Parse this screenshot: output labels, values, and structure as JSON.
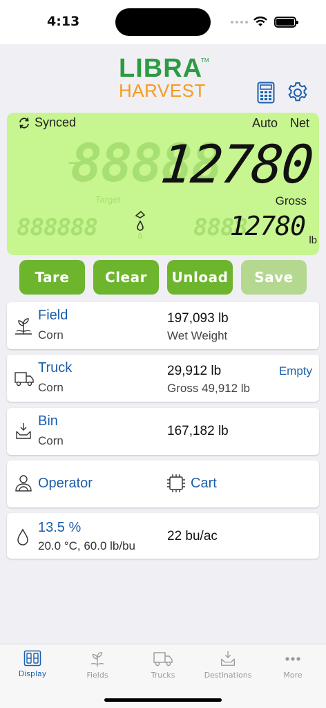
{
  "status_bar": {
    "time": "4:13"
  },
  "header": {
    "logo_top": "LIBRA",
    "logo_tm": "TM",
    "logo_bottom": "HARVEST"
  },
  "scale_display": {
    "sync_status": "Synced",
    "mode_auto": "Auto",
    "mode_net": "Net",
    "weight": "12780",
    "weight_type": "Gross",
    "target_label": "Target",
    "secondary_weight": "12780",
    "unit": "lb",
    "ghost_big": "88888",
    "ghost_small_left": "888888",
    "ghost_small_right": "8888"
  },
  "actions": {
    "tare": "Tare",
    "clear": "Clear",
    "unload": "Unload",
    "save": "Save"
  },
  "field_card": {
    "title": "Field",
    "crop": "Corn",
    "value": "197,093 lb",
    "value_label": "Wet Weight"
  },
  "truck_card": {
    "title": "Truck",
    "crop": "Corn",
    "value": "29,912 lb",
    "value_label": "Gross 49,912 lb",
    "action": "Empty"
  },
  "bin_card": {
    "title": "Bin",
    "crop": "Corn",
    "value": "167,182 lb"
  },
  "operator_card": {
    "operator": "Operator",
    "cart": "Cart"
  },
  "moisture_card": {
    "moisture": "13.5 %",
    "conditions": "20.0 °C, 60.0 lb/bu",
    "yield": "22 bu/ac"
  },
  "tabs": [
    {
      "label": "Display",
      "icon": "display-icon",
      "active": true
    },
    {
      "label": "Fields",
      "icon": "sprout-icon",
      "active": false
    },
    {
      "label": "Trucks",
      "icon": "truck-icon",
      "active": false
    },
    {
      "label": "Destinations",
      "icon": "bin-icon",
      "active": false
    },
    {
      "label": "More",
      "icon": "more-icon",
      "active": false
    }
  ],
  "colors": {
    "accent_green": "#6cb52d",
    "display_bg": "#c7f58f",
    "link_blue": "#1b5fad",
    "logo_green": "#2c9b42",
    "logo_orange": "#f39c1f"
  }
}
